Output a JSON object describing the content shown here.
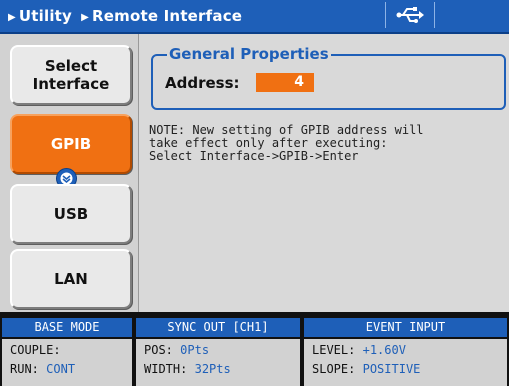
{
  "title_bar": {
    "breadcrumb": [
      "Utility",
      "Remote Interface"
    ],
    "usb_icon": "usb-icon"
  },
  "menu": {
    "items": [
      {
        "label_line1": "Select",
        "label_line2": "Interface"
      },
      {
        "label": "GPIB"
      },
      {
        "label": "USB"
      },
      {
        "label": "LAN"
      }
    ],
    "selected": "GPIB",
    "chevron_icon": "chevron-down-icon"
  },
  "general_properties": {
    "title": "General Properties",
    "address_label": "Address:",
    "address_value": "4"
  },
  "note": "NOTE: New setting of GPIB address will\ntake effect only after executing:\nSelect Interface->GPIB->Enter",
  "status": {
    "base_mode": {
      "header": "BASE MODE",
      "couple_label": "COUPLE:",
      "couple_value": "",
      "run_label": "RUN:",
      "run_value": "CONT"
    },
    "sync_out": {
      "header": "SYNC OUT [CH1]",
      "pos_label": "POS:",
      "pos_value": "0Pts",
      "width_label": "WIDTH:",
      "width_value": "32Pts"
    },
    "event_input": {
      "header": "EVENT INPUT",
      "level_label": "LEVEL:",
      "level_value": "+1.60V",
      "slope_label": "SLOPE:",
      "slope_value": "POSITIVE"
    }
  },
  "colors": {
    "accent": "#1e5fb8",
    "selected": "#f07012",
    "panel": "#d9d9d9"
  }
}
